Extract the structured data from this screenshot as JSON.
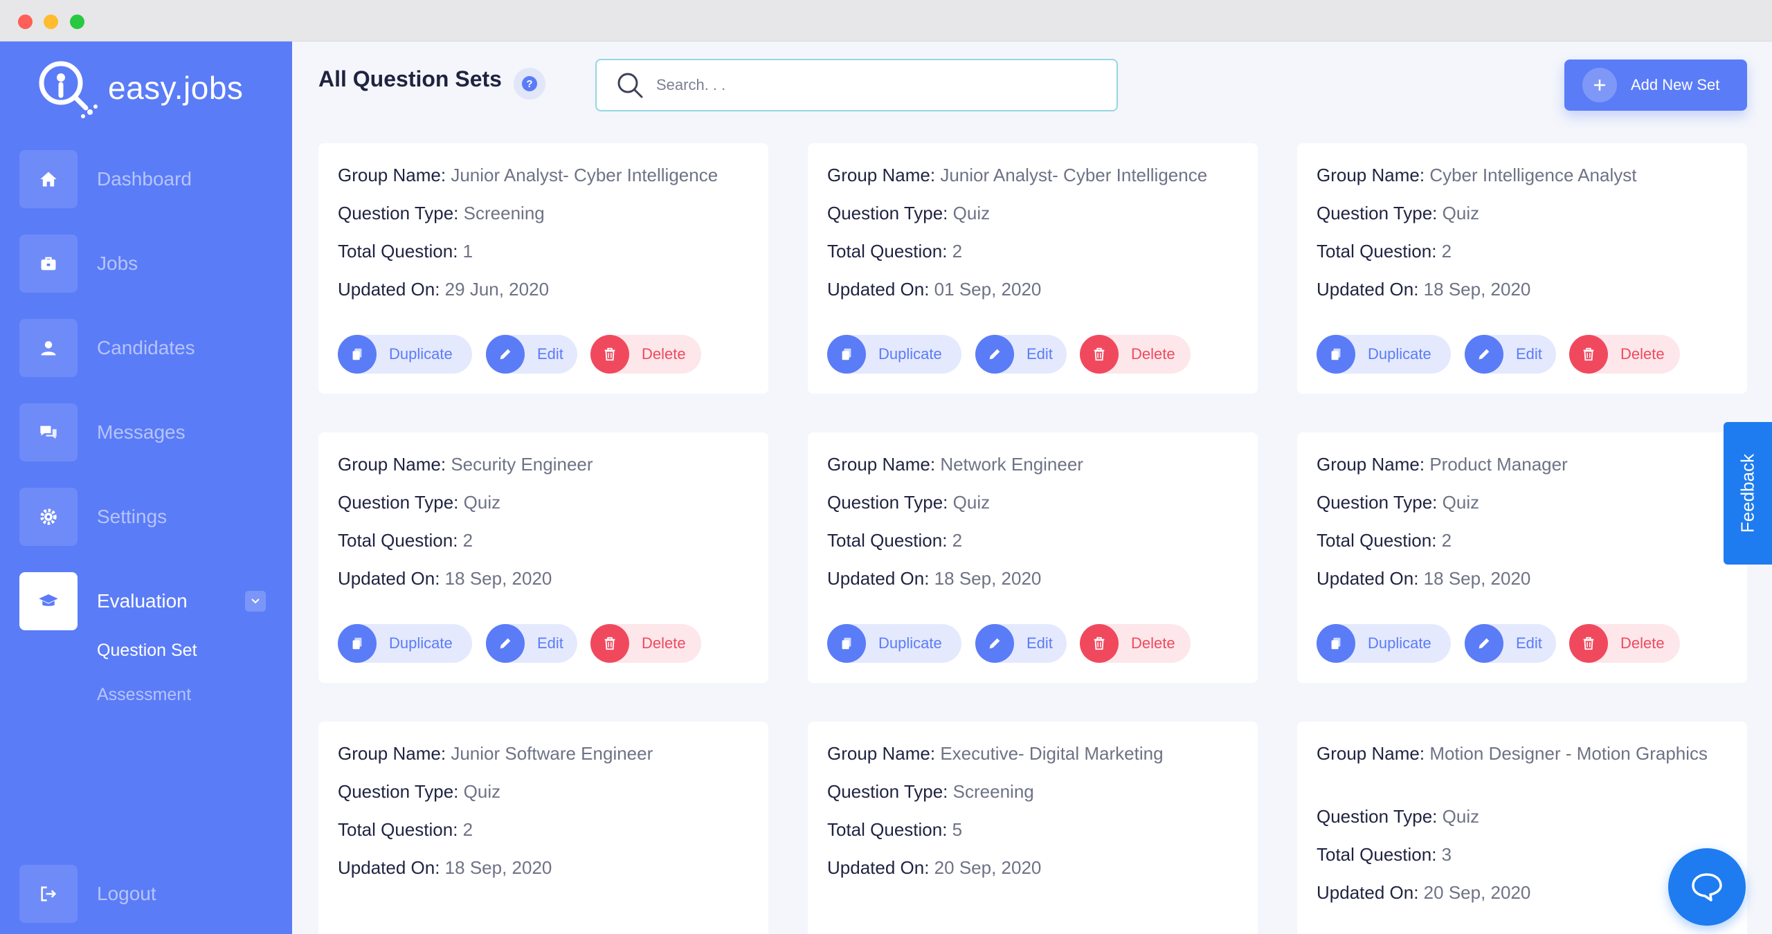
{
  "app": {
    "logo_text": "easy.jobs"
  },
  "sidebar": {
    "items": [
      {
        "label": "Dashboard",
        "icon": "home-icon"
      },
      {
        "label": "Jobs",
        "icon": "briefcase-icon"
      },
      {
        "label": "Candidates",
        "icon": "user-icon"
      },
      {
        "label": "Messages",
        "icon": "chat-icon"
      },
      {
        "label": "Settings",
        "icon": "gear-icon"
      },
      {
        "label": "Evaluation",
        "icon": "graduation-cap-icon",
        "active": true
      }
    ],
    "sub_items": [
      {
        "label": "Question Set",
        "active": true
      },
      {
        "label": "Assessment"
      }
    ],
    "logout": {
      "label": "Logout",
      "icon": "logout-icon"
    }
  },
  "header": {
    "title": "All Question Sets",
    "search_placeholder": "Search. . .",
    "add_button": "Add New Set"
  },
  "labels": {
    "group": "Group Name:",
    "type": "Question Type:",
    "total": "Total Question:",
    "updated": "Updated On:",
    "duplicate": "Duplicate",
    "edit": "Edit",
    "delete": "Delete"
  },
  "cards": [
    {
      "group": "Junior Analyst- Cyber Intelligence",
      "type": "Screening",
      "total": "1",
      "updated": "29 Jun, 2020"
    },
    {
      "group": "Junior Analyst- Cyber Intelligence",
      "type": "Quiz",
      "total": "2",
      "updated": "01 Sep, 2020"
    },
    {
      "group": "Cyber Intelligence Analyst",
      "type": "Quiz",
      "total": "2",
      "updated": "18 Sep, 2020"
    },
    {
      "group": "Security Engineer",
      "type": "Quiz",
      "total": "2",
      "updated": "18 Sep, 2020"
    },
    {
      "group": "Network Engineer",
      "type": "Quiz",
      "total": "2",
      "updated": "18 Sep, 2020"
    },
    {
      "group": "Product Manager",
      "type": "Quiz",
      "total": "2",
      "updated": "18 Sep, 2020"
    },
    {
      "group": "Junior Software Engineer",
      "type": "Quiz",
      "total": "2",
      "updated": "18 Sep, 2020"
    },
    {
      "group": "Executive- Digital Marketing",
      "type": "Screening",
      "total": "5",
      "updated": "20 Sep, 2020"
    },
    {
      "group": "Motion Designer - Motion Graphics",
      "type": "Quiz",
      "total": "3",
      "updated": "20 Sep, 2020"
    }
  ],
  "feedback": {
    "label": "Feedback"
  },
  "colors": {
    "brand": "#5b7cf7",
    "danger": "#f0495e",
    "feedback": "#1e7cf0"
  }
}
